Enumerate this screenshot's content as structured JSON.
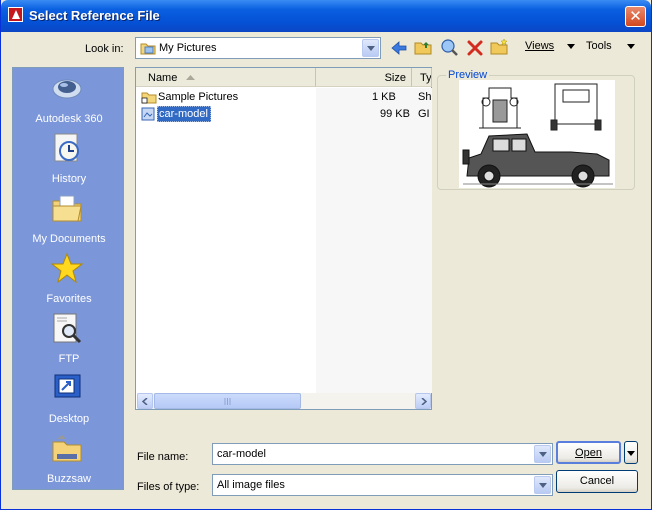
{
  "window": {
    "title": "Select Reference File"
  },
  "toolbar": {
    "look_in_label": "Look in:",
    "look_in_value": "My Pictures",
    "views_label": "Views",
    "tools_label": "Tools",
    "icons": [
      "back-arrow-icon",
      "up-folder-icon",
      "search-web-icon",
      "delete-icon",
      "new-folder-icon"
    ]
  },
  "places": [
    {
      "label": "Autodesk 360",
      "icon": "autodesk-360-icon"
    },
    {
      "label": "History",
      "icon": "history-icon"
    },
    {
      "label": "My Documents",
      "icon": "my-documents-icon"
    },
    {
      "label": "Favorites",
      "icon": "favorites-icon"
    },
    {
      "label": "FTP",
      "icon": "ftp-icon"
    },
    {
      "label": "Desktop",
      "icon": "desktop-icon"
    },
    {
      "label": "Buzzsaw",
      "icon": "buzzsaw-icon"
    }
  ],
  "file_list": {
    "columns": [
      "Name",
      "Size",
      "Ty"
    ],
    "rows": [
      {
        "name": "Sample Pictures",
        "size": "1 KB",
        "type": "Sh",
        "icon": "folder-shortcut-icon",
        "selected": false
      },
      {
        "name": "car-model",
        "size": "99 KB",
        "type": "GI",
        "icon": "image-file-icon",
        "selected": true
      }
    ]
  },
  "preview": {
    "label": "Preview"
  },
  "bottom": {
    "file_name_label": "File name:",
    "file_name_value": "car-model",
    "file_type_label": "Files of type:",
    "file_type_value": "All image files",
    "open_label": "Open",
    "cancel_label": "Cancel"
  },
  "colors": {
    "titlebar": "#0a5fe0",
    "places_panel": "#7b96d9",
    "selection": "#316ac5",
    "dialog_bg": "#ece9d8"
  }
}
